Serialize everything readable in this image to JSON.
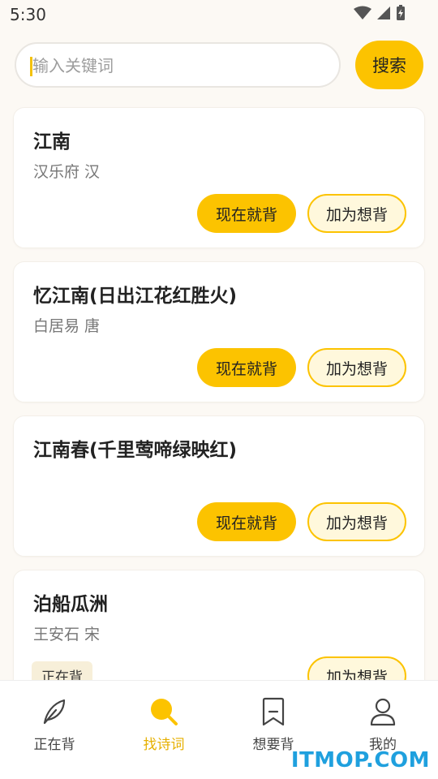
{
  "status": {
    "time": "5:30"
  },
  "search": {
    "placeholder": "输入关键词",
    "button": "搜索"
  },
  "poems": [
    {
      "title": "江南",
      "author": "汉乐府  汉",
      "now_label": "现在就背",
      "want_label": "加为想背"
    },
    {
      "title": "忆江南(日出江花红胜火)",
      "author": "白居易  唐",
      "now_label": "现在就背",
      "want_label": "加为想背"
    },
    {
      "title": "江南春(千里莺啼绿映红)",
      "author": "",
      "now_label": "现在就背",
      "want_label": "加为想背"
    },
    {
      "title": "泊船瓜洲",
      "author": "王安石  宋",
      "badge": "正在背",
      "want_label": "加为想背"
    }
  ],
  "nav": [
    {
      "label": "正在背",
      "icon": "feather-icon"
    },
    {
      "label": "找诗词",
      "icon": "search-icon",
      "active": true
    },
    {
      "label": "想要背",
      "icon": "bookmark-icon"
    },
    {
      "label": "我的",
      "icon": "person-icon"
    }
  ],
  "watermark": "ITMOP.COM",
  "colors": {
    "accent": "#fcc300",
    "background": "#fcf9f4",
    "watermark": "#1fa0de"
  }
}
